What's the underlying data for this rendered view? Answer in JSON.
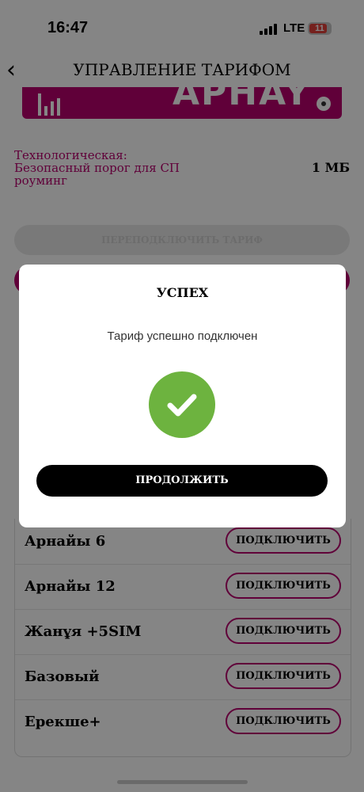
{
  "status_bar": {
    "time": "16:47",
    "network": "LTE",
    "battery": "11"
  },
  "header": {
    "title": "УПРАВЛЕНИЕ ТАРИФОМ"
  },
  "background": {
    "tech_label": "Технологическая: Безопасный порог для СП роуминг",
    "tech_value": "1 МБ",
    "reconnect_label": "ПЕРЕПОДКЛЮЧИТЬ ТАРИФ"
  },
  "tariffs": [
    {
      "name": "Арнайы 6",
      "button": "ПОДКЛЮЧИТЬ"
    },
    {
      "name": "Арнайы 12",
      "button": "ПОДКЛЮЧИТЬ"
    },
    {
      "name": "Жанұя +5SIM",
      "button": "ПОДКЛЮЧИТЬ"
    },
    {
      "name": "Базовый",
      "button": "ПОДКЛЮЧИТЬ"
    },
    {
      "name": "Ерекше+",
      "button": "ПОДКЛЮЧИТЬ"
    }
  ],
  "modal": {
    "title": "УСПЕХ",
    "message": "Тариф успешно подключен",
    "continue_label": "ПРОДОЛЖИТЬ",
    "icon": "check-circle-icon"
  },
  "colors": {
    "accent": "#b8006e",
    "success": "#6db33f"
  }
}
